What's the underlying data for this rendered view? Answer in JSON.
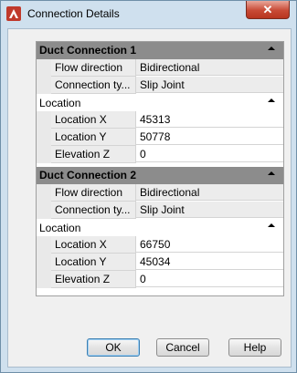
{
  "window": {
    "title": "Connection Details",
    "close_glyph": "✕"
  },
  "sections": [
    {
      "header": "Duct Connection 1",
      "general": [
        {
          "label": "Flow direction",
          "value": "Bidirectional"
        },
        {
          "label": "Connection ty...",
          "value": "Slip Joint"
        }
      ],
      "location_label": "Location",
      "location": [
        {
          "label": "Location X",
          "value": "45313"
        },
        {
          "label": "Location Y",
          "value": "50778"
        },
        {
          "label": "Elevation Z",
          "value": "0"
        }
      ]
    },
    {
      "header": "Duct Connection 2",
      "general": [
        {
          "label": "Flow direction",
          "value": "Bidirectional"
        },
        {
          "label": "Connection ty...",
          "value": "Slip Joint"
        }
      ],
      "location_label": "Location",
      "location": [
        {
          "label": "Location X",
          "value": "66750"
        },
        {
          "label": "Location Y",
          "value": "45034"
        },
        {
          "label": "Elevation Z",
          "value": "0"
        }
      ]
    }
  ],
  "buttons": {
    "ok": "OK",
    "cancel": "Cancel",
    "help": "Help"
  },
  "colors": {
    "accent_red": "#c0392b",
    "header_gray": "#8c8c8c"
  }
}
